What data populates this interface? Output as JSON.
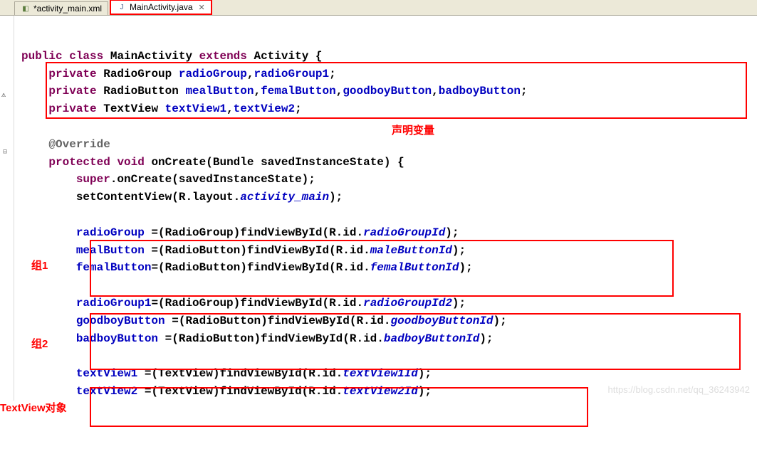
{
  "tabs": {
    "tab1": {
      "label": "*activity_main.xml"
    },
    "tab2": {
      "label": "MainActivity.java"
    }
  },
  "annotations": {
    "declare_vars": "声明变量",
    "group1": "组1",
    "group2": "组2",
    "textview_obj": "TextView对象"
  },
  "code": {
    "l1_kw1": "public",
    "l1_kw2": "class",
    "l1_name": " MainActivity ",
    "l1_kw3": "extends",
    "l1_sup": " Activity {",
    "l2_kw": "private",
    "l2_type": " RadioGroup ",
    "l2_f1": "radioGroup",
    "l2_c": ",",
    "l2_f2": "radioGroup1",
    "l2_e": ";",
    "l3_kw": "private",
    "l3_type": " RadioButton ",
    "l3_f1": "mealButton",
    "l3_c1": ",",
    "l3_f2": "femalButton",
    "l3_c2": ",",
    "l3_f3": "goodboyButton",
    "l3_c3": ",",
    "l3_f4": "badboyButton",
    "l3_e": ";",
    "l4_kw": "private",
    "l4_type": " TextView ",
    "l4_f1": "textView1",
    "l4_c": ",",
    "l4_f2": "textView2",
    "l4_e": ";",
    "l5_ann": "@Override",
    "l6_kw1": "protected",
    "l6_kw2": "void",
    "l6_rest": " onCreate(Bundle savedInstanceState) {",
    "l7_kw": "super",
    "l7_rest": ".onCreate(savedInstanceState);",
    "l8_a": "setContentView(R.layout.",
    "l8_b": "activity_main",
    "l8_c": ");",
    "l9_f": "radioGroup",
    "l9_a": " =(RadioGroup)findViewById(R.id.",
    "l9_b": "radioGroupId",
    "l9_c": ");",
    "l10_f": "mealButton",
    "l10_a": " =(RadioButton)findViewById(R.id.",
    "l10_b": "maleButtonId",
    "l10_c": ");",
    "l11_f": "femalButton",
    "l11_a": "=(RadioButton)findViewById(R.id.",
    "l11_b": "femalButtonId",
    "l11_c": ");",
    "l12_f": "radioGroup1",
    "l12_a": "=(RadioGroup)findViewById(R.id.",
    "l12_b": "radioGroupId2",
    "l12_c": ");",
    "l13_f": "goodboyButton",
    "l13_a": " =(RadioButton)findViewById(R.id.",
    "l13_b": "goodboyButtonId",
    "l13_c": ");",
    "l14_f": "badboyButton",
    "l14_a": " =(RadioButton)findViewById(R.id.",
    "l14_b": "badboyButtonId",
    "l14_c": ");",
    "l15_f": "textView1",
    "l15_a": " =(TextView)findViewById(R.id.",
    "l15_b": "textView1Id",
    "l15_c": ");",
    "l16_f": "textView2",
    "l16_a": " =(TextView)findViewById(R.id.",
    "l16_b": "textView2Id",
    "l16_c": ");"
  },
  "watermark": "https://blog.csdn.net/qq_36243942"
}
